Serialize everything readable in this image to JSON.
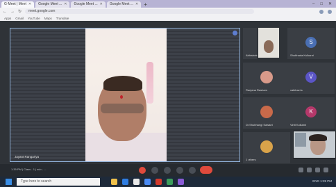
{
  "browser": {
    "tabs": [
      {
        "label": "G·Meet | Meet",
        "active": true
      },
      {
        "label": "Google Meet ...",
        "active": false
      },
      {
        "label": "Google Meet ...",
        "active": false
      },
      {
        "label": "Google Meet ...",
        "active": false
      }
    ],
    "new_tab": "+",
    "window_buttons": [
      "–",
      "□",
      "✕"
    ],
    "url": "meet.google.com",
    "bookmarks": [
      "Apps",
      "Gmail",
      "YouTube",
      "Maps",
      "Translate"
    ]
  },
  "meet": {
    "main_speaker_name": "Jayant Rangariya",
    "participants": [
      {
        "name": "Abhishek",
        "initial": "",
        "kind": "camera"
      },
      {
        "name": "Shubhada Kulkarni",
        "initial": "S",
        "color": "#4a6fb3"
      },
      {
        "name": "Ranjana Rasham",
        "initial": "",
        "kind": "photo",
        "color": "#d89a8a"
      },
      {
        "name": "vaibhavi.s",
        "initial": "V",
        "color": "#5b55c7"
      },
      {
        "name": "Dr.Shubhangi Sawant",
        "initial": "",
        "kind": "photo",
        "color": "#c96a4a"
      },
      {
        "name": "Vinit Kulkarni",
        "initial": "K",
        "color": "#b5386a"
      },
      {
        "name": "1 others",
        "initial": "",
        "kind": "photo",
        "color": "#d9a34a"
      },
      {
        "name": "",
        "initial": "",
        "kind": "photo",
        "color": "#7aa0c9"
      }
    ],
    "meeting_details": "1:39 PM | Class - 1 | sub - ...",
    "controls": [
      "mic",
      "camera",
      "captions",
      "present",
      "more",
      "leave"
    ]
  },
  "taskbar": {
    "search_placeholder": "Type here to search",
    "tray_text": "ENG  1:39 PM"
  }
}
